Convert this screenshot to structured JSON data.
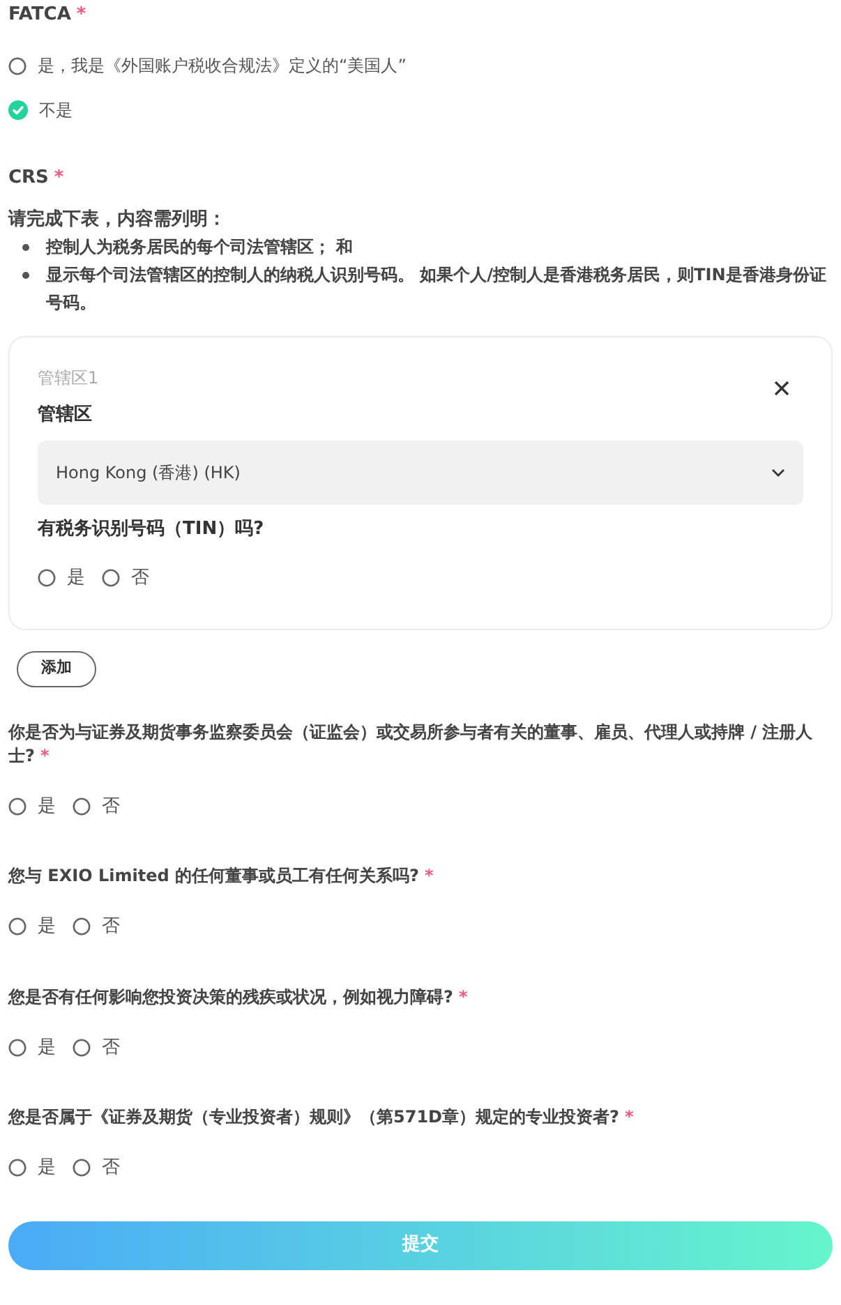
{
  "fatca": {
    "label": "FATCA",
    "required_mark": "*",
    "options": [
      {
        "label": "是，我是《外国账户税收合规法》定义的“美国人”",
        "selected": false
      },
      {
        "label": "不是",
        "selected": true
      }
    ]
  },
  "crs": {
    "label": "CRS",
    "required_mark": "*",
    "intro": "请完成下表，内容需列明：",
    "bullets": [
      "控制人为税务居民的每个司法管辖区； 和",
      "显示每个司法管辖区的控制人的纳税人识别号码。 如果个人/控制人是香港税务居民，则TIN是香港身份证号码。"
    ],
    "jurisdictions": [
      {
        "caption": "管辖区1",
        "field_label": "管辖区",
        "value": "Hong Kong (香港) (HK)",
        "tin_question": "有税务识别号码（TIN）吗?",
        "options": [
          {
            "label": "是",
            "selected": false
          },
          {
            "label": "否",
            "selected": false
          }
        ]
      }
    ],
    "add_button": "添加"
  },
  "questions": [
    {
      "text": "你是否为与证券及期货事务监察委员会（证监会）或交易所参与者有关的董事、雇员、代理人或持牌 / 注册人士?",
      "required_mark": "*",
      "options": [
        {
          "label": "是",
          "selected": false
        },
        {
          "label": "否",
          "selected": false
        }
      ]
    },
    {
      "text": "您与 EXIO Limited 的任何董事或员工有任何关系吗?",
      "required_mark": "*",
      "options": [
        {
          "label": "是",
          "selected": false
        },
        {
          "label": "否",
          "selected": false
        }
      ]
    },
    {
      "text": "您是否有任何影响您投资决策的残疾或状况，例如视力障碍?",
      "required_mark": "*",
      "options": [
        {
          "label": "是",
          "selected": false
        },
        {
          "label": "否",
          "selected": false
        }
      ]
    },
    {
      "text": "您是否属于《证券及期货（专业投资者）规则》（第571D章）规定的专业投资者?",
      "required_mark": "*",
      "options": [
        {
          "label": "是",
          "selected": false
        },
        {
          "label": "否",
          "selected": false
        }
      ]
    }
  ],
  "submit_button": "提交"
}
